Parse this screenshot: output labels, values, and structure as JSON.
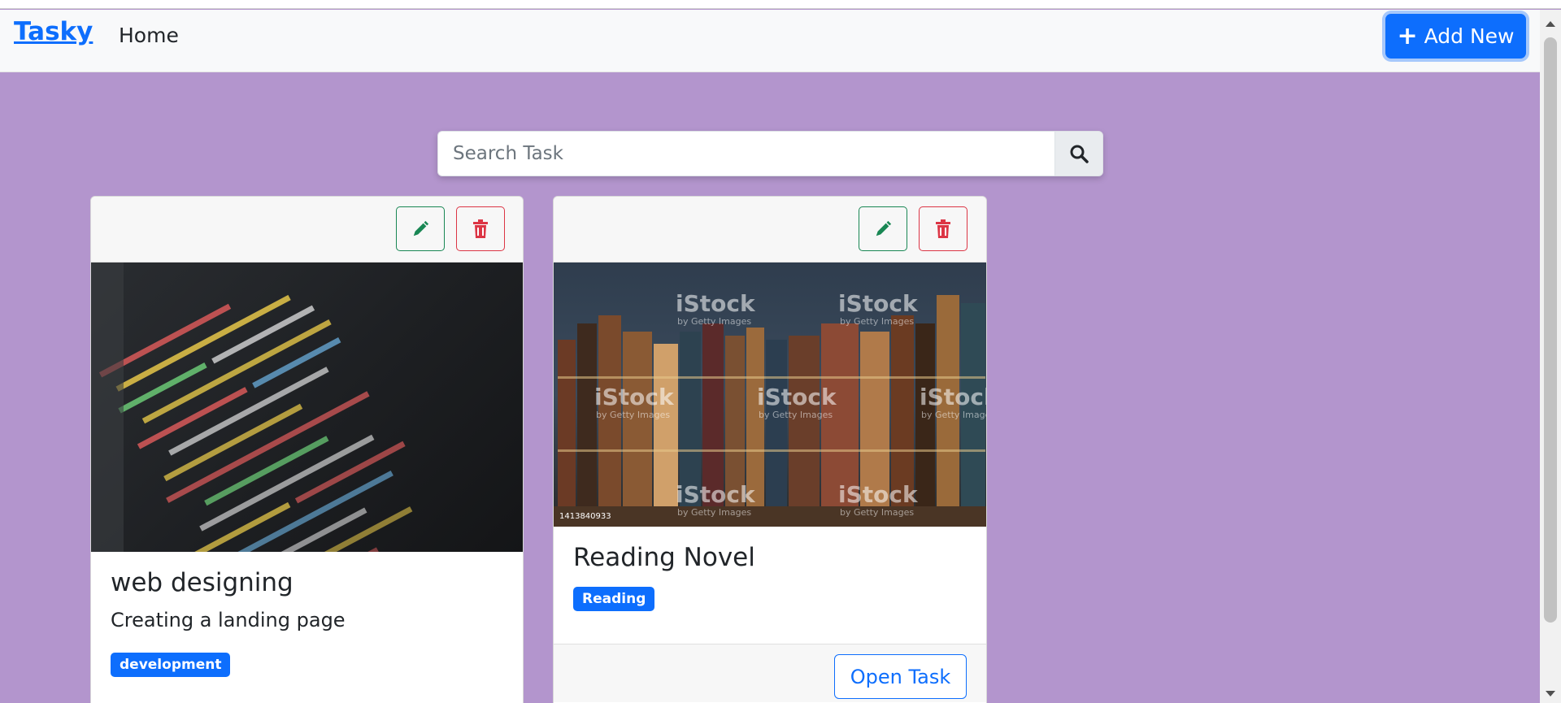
{
  "nav": {
    "brand": "Tasky",
    "home_label": "Home",
    "add_new_label": "Add New"
  },
  "search": {
    "placeholder": "Search Task",
    "value": ""
  },
  "tasks": [
    {
      "title": "web designing",
      "description": "Creating a landing page",
      "tag": "development",
      "image_desc": "code-editor-screenshot"
    },
    {
      "title": "Reading Novel",
      "description": "",
      "tag": "Reading",
      "image_desc": "antique-books-on-shelf",
      "watermark": "iStock",
      "watermark_sub": "by Getty Images",
      "image_id": "1413840933",
      "open_label": "Open Task"
    }
  ],
  "colors": {
    "page_bg": "#b395cd",
    "primary": "#0d6efd",
    "success": "#198754",
    "danger": "#dc3545"
  },
  "icons": [
    "plus-icon",
    "search-icon",
    "pencil-icon",
    "trash-icon"
  ]
}
